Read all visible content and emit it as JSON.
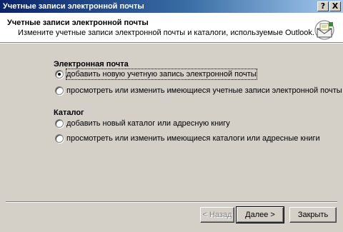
{
  "window": {
    "title": "Учетные записи электронной почты",
    "help_glyph": "?",
    "close_glyph": "X"
  },
  "header": {
    "title": "Учетные записи электронной почты",
    "subtitle": "Измените учетные записи электронной почты и каталоги, используемые Outlook.",
    "icon": "mail-envelope-icon"
  },
  "email_section": {
    "label": "Электронная почта",
    "options": [
      {
        "label": "добавить новую учетную запись электронной почты",
        "selected": true
      },
      {
        "label": "просмотреть или изменить имеющиеся учетные записи электронной почты",
        "selected": false
      }
    ]
  },
  "directory_section": {
    "label": "Каталог",
    "options": [
      {
        "label": "добавить новый каталог или адресную книгу",
        "selected": false
      },
      {
        "label": "просмотреть или изменить имеющиеся каталоги или адресные книги",
        "selected": false
      }
    ]
  },
  "buttons": {
    "back": "< Назад",
    "next": "Далее >",
    "cancel": "Закрыть"
  }
}
